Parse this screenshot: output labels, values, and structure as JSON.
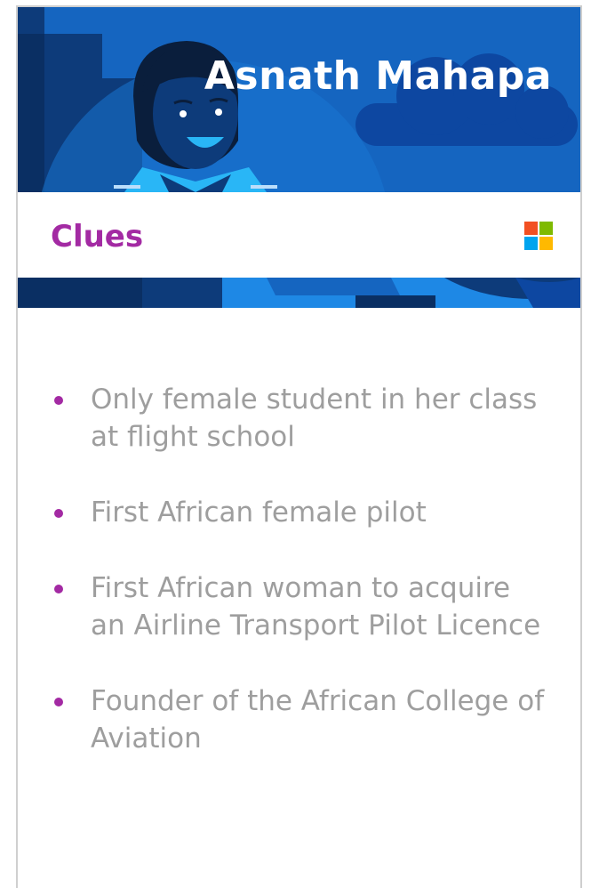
{
  "card": {
    "title": "Asnath Mahapa",
    "section_label": "Clues",
    "brand_icon": "microsoft-logo",
    "clues": [
      "Only female student in her class at flight school",
      "First African female pilot",
      "First African woman to acquire an Airline Transport Pilot Licence",
      "Founder of the African College of Aviation"
    ]
  },
  "colors": {
    "hero_blue": "#1565c0",
    "accent_purple": "#a32aa3",
    "clue_text": "#9e9e9e"
  }
}
